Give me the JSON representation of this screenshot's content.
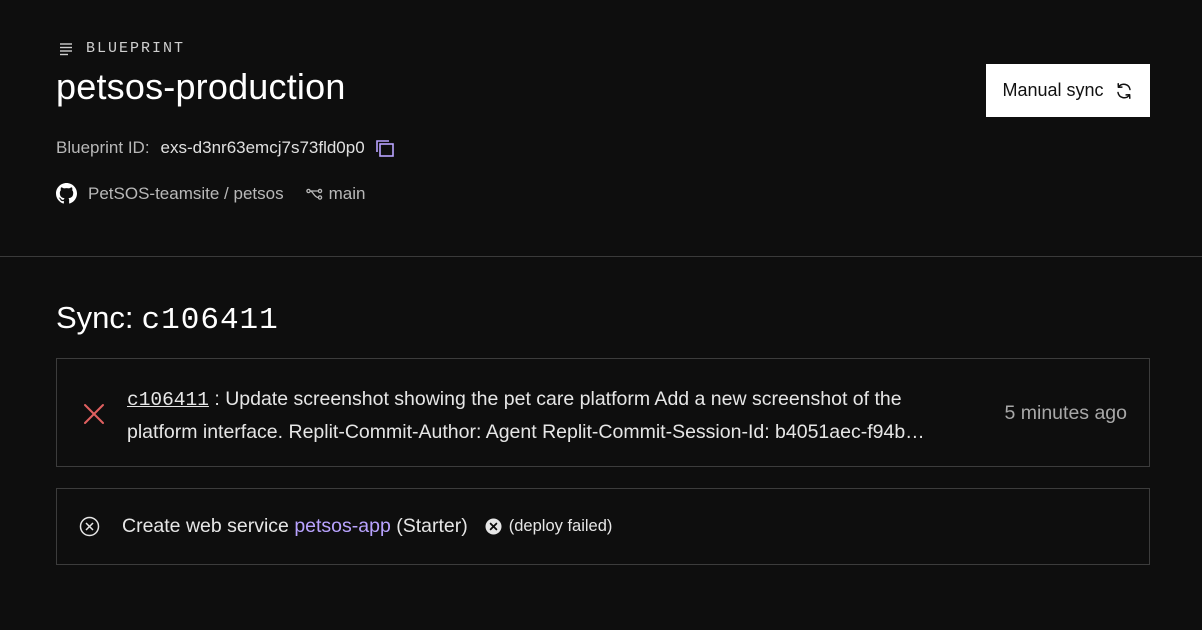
{
  "header": {
    "eyebrow": "BLUEPRINT",
    "title": "petsos-production",
    "manual_sync_label": "Manual sync",
    "blueprint_id_label": "Blueprint ID:",
    "blueprint_id_value": "exs-d3nr63emcj7s73fld0p0",
    "repo": "PetSOS-teamsite / petsos",
    "branch": "main"
  },
  "sync": {
    "title_prefix": "Sync:",
    "commit_id": "c106411",
    "commit": {
      "hash": "c106411",
      "separator": " : ",
      "message_line1": "Update screenshot showing the pet care platform Add a new screenshot of the",
      "message_line2": "platform interface. Replit-Commit-Author: Agent Replit-Commit-Session-Id: b4051aec-f94b…",
      "time": "5 minutes ago"
    },
    "event": {
      "prefix": "Create web service ",
      "service_name": "petsos-app",
      "plan": " (Starter)",
      "status": "(deploy failed)"
    }
  },
  "colors": {
    "background": "#0e0e0e",
    "accent_link": "#b9a3ff",
    "error_x": "#e06060"
  },
  "icons": [
    "list-icon",
    "refresh-icon",
    "copy-icon",
    "github-icon",
    "branch-icon",
    "error-x-icon",
    "circle-x-icon",
    "failed-badge-icon"
  ]
}
